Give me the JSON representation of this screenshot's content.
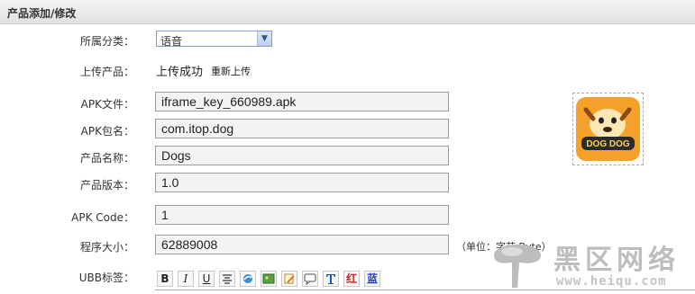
{
  "header": {
    "title": "产品添加/修改"
  },
  "form": {
    "category": {
      "label": "所属分类：",
      "value": "语音"
    },
    "upload": {
      "label": "上传产品：",
      "status": "上传成功",
      "reupload": "重新上传"
    },
    "apk_file": {
      "label": "APK文件：",
      "value": "iframe_key_660989.apk"
    },
    "apk_package": {
      "label": "APK包名：",
      "value": "com.itop.dog"
    },
    "product_name": {
      "label": "产品名称：",
      "value": "Dogs"
    },
    "product_version": {
      "label": "产品版本：",
      "value": "1.0"
    },
    "apk_code": {
      "label": "APK Code：",
      "value": "1"
    },
    "program_size": {
      "label": "程序大小：",
      "value": "62889008",
      "unit": "（单位：字节 Byte）"
    },
    "ubb": {
      "label": "UBB标签："
    }
  },
  "toolbar": {
    "bold": "B",
    "italic": "I",
    "underline": "U",
    "red": "红",
    "blue": "蓝"
  },
  "thumbnail": {
    "text": "DOG DOG"
  },
  "watermark": {
    "text": "黑区网络",
    "url": "www.heiqu.com"
  }
}
